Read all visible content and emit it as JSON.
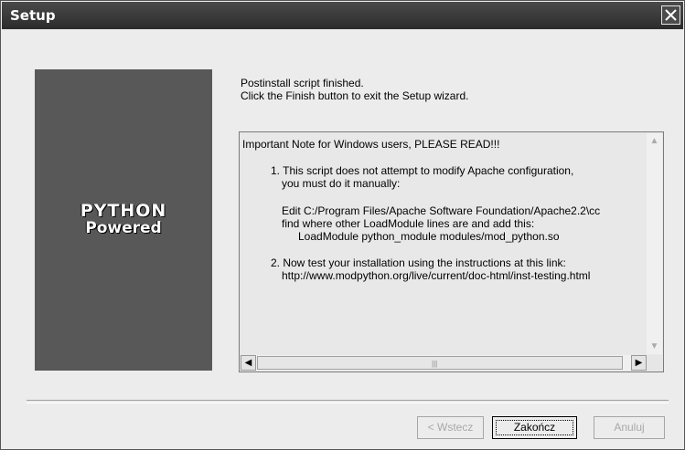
{
  "window": {
    "title": "Setup",
    "close_label": "close"
  },
  "logo": {
    "line1": "PYTHON",
    "line2": "Powered"
  },
  "message": {
    "line1": "Postinstall script finished.",
    "line2": "Click the Finish button to exit the Setup wizard."
  },
  "log": {
    "lines": [
      "Important Note for Windows users, PLEASE READ!!!",
      "1. This script does not attempt to modify Apache configuration,",
      "you must do it manually:",
      "Edit C:/Program Files/Apache Software Foundation/Apache2.2\\cc",
      "find where other LoadModule lines are and add this:",
      "LoadModule python_module modules/mod_python.so",
      "2. Now test your installation using the instructions at this link:",
      "http://www.modpython.org/live/current/doc-html/inst-testing.html"
    ]
  },
  "buttons": {
    "back": "< Wstecz",
    "finish": "Zakończ",
    "cancel": "Anuluj"
  }
}
